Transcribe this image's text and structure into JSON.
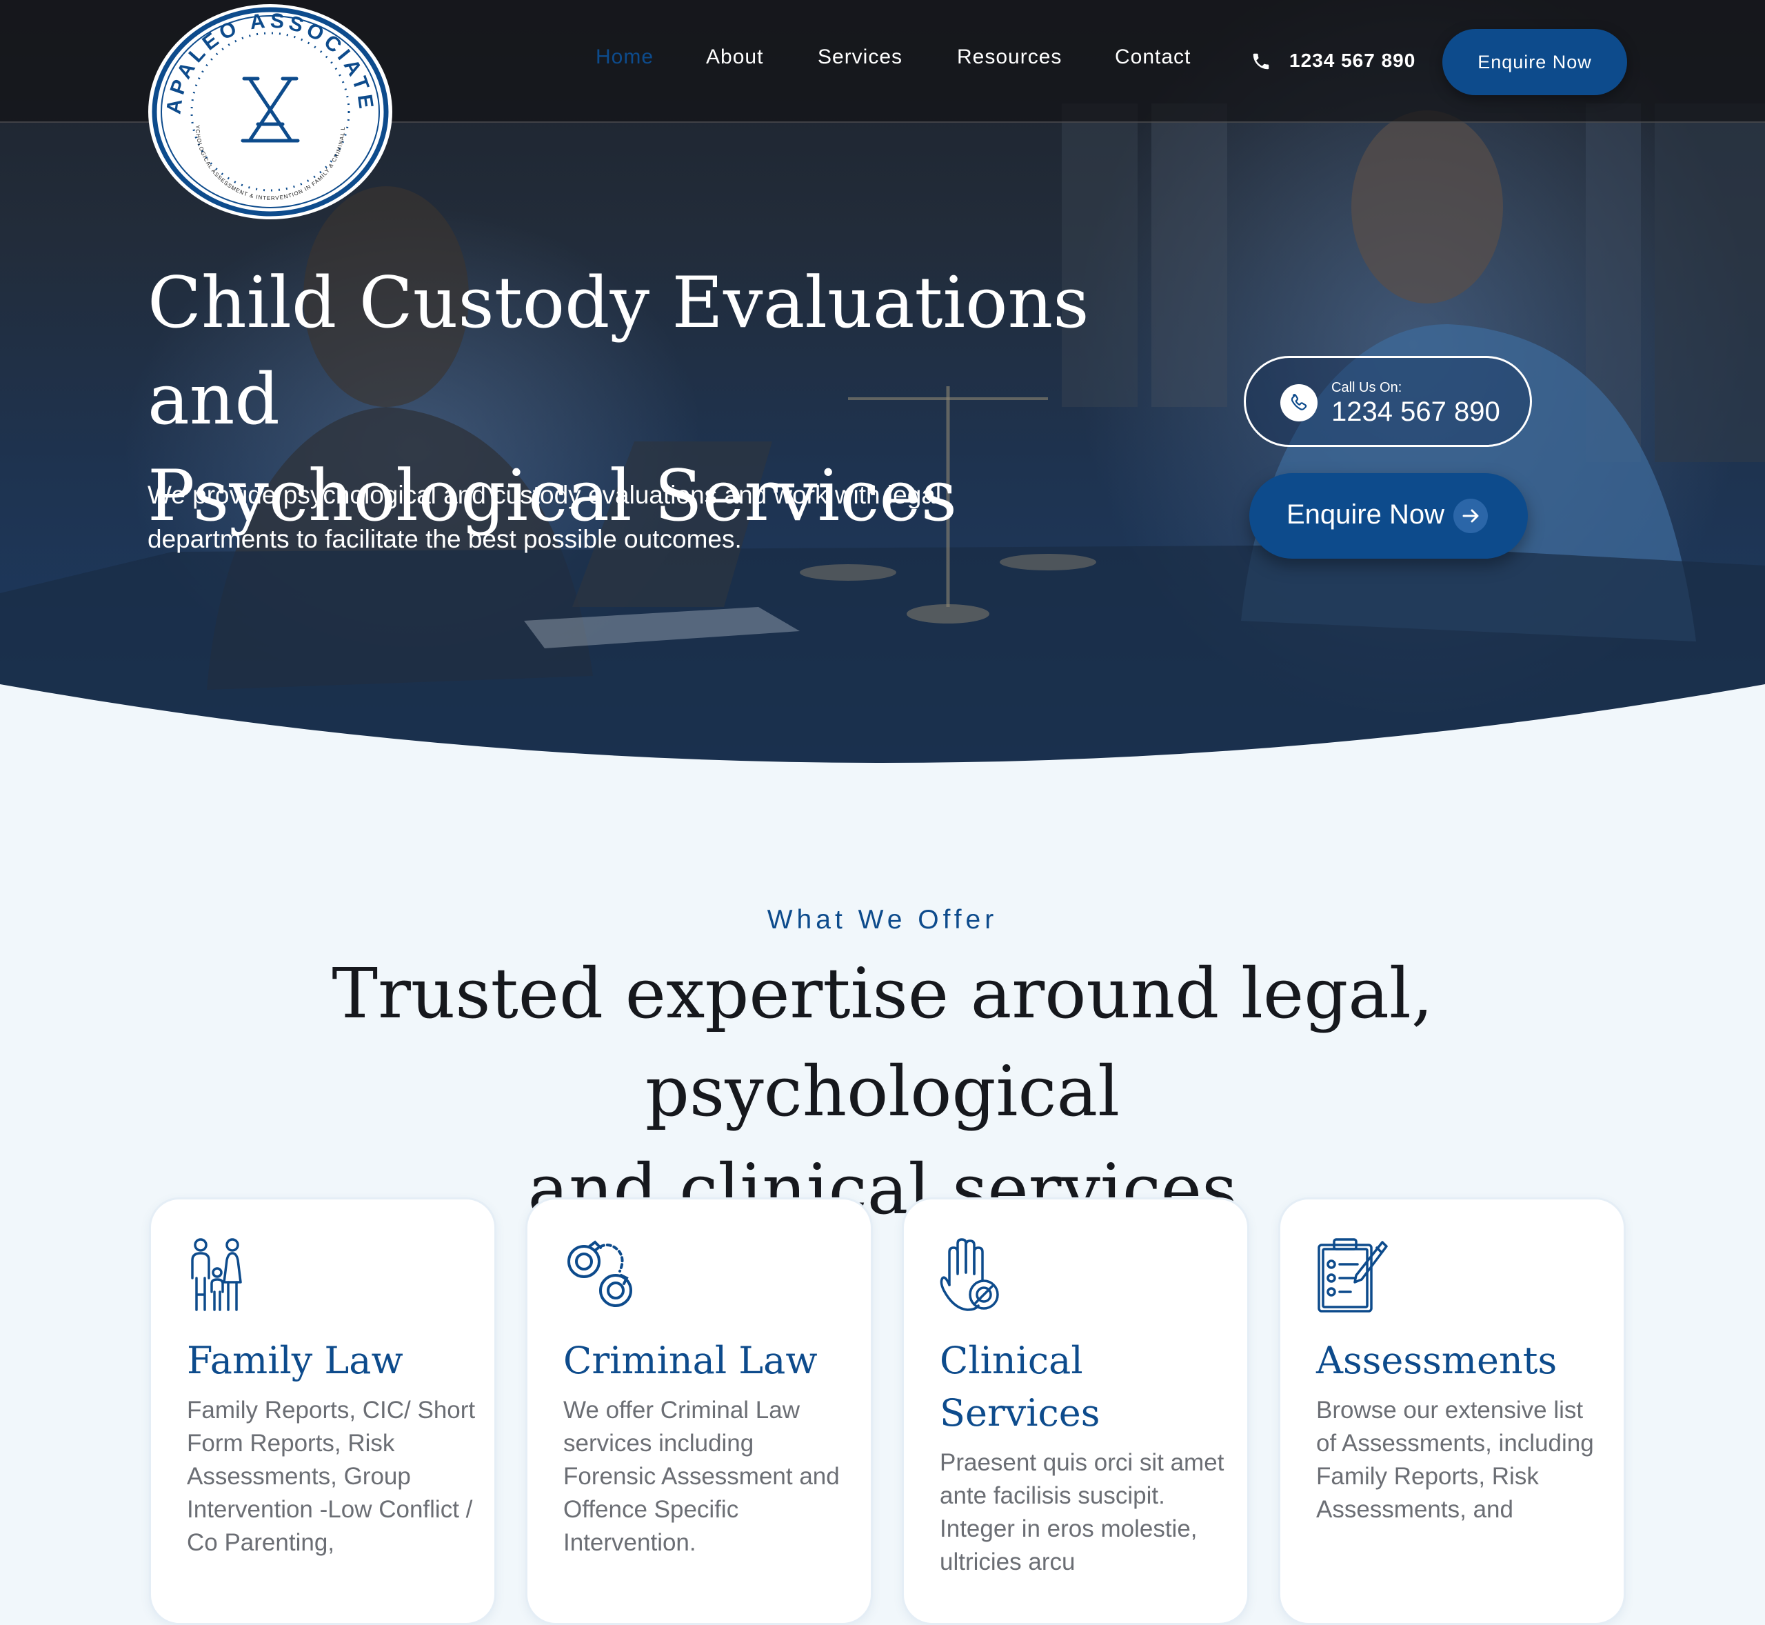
{
  "logo": {
    "arc_text": "PAPALEO ASSOCIATES",
    "tagline": "PSYCHOLOGICAL ASSESSMENT & INTERVENTION IN FAMILY & CRIMINAL LAW"
  },
  "nav": {
    "items": [
      "Home",
      "About",
      "Services",
      "Resources",
      "Contact"
    ],
    "active": "Home",
    "phone": "1234 567 890",
    "cta": "Enquire Now"
  },
  "hero": {
    "title_line1": "Child Custody Evaluations and",
    "title_line2": "Psychological Services",
    "subtitle_line1": "We provide psychological and custody evaluations and work with legal",
    "subtitle_line2": "departments to facilitate the best possible outcomes.",
    "call_label": "Call Us On:",
    "call_number": "1234 567 890",
    "cta": "Enquire Now"
  },
  "offer": {
    "eyebrow": "What We Offer",
    "title_line1": "Trusted expertise around legal, psychological",
    "title_line2": "and clinical services",
    "cards": [
      {
        "icon": "family-icon",
        "title": "Family Law",
        "text": "Family Reports, CIC/ Short Form Reports, Risk Assessments, Group Intervention -Low Conflict / Co Parenting,"
      },
      {
        "icon": "handcuffs-icon",
        "title": "Criminal Law",
        "text": "We offer Criminal Law services including Forensic Assessment and Offence Specific Intervention."
      },
      {
        "icon": "hand-stop-icon",
        "title": "Clinical Services",
        "text": "Praesent quis orci sit amet ante facilisis suscipit. Integer in eros molestie, ultricies arcu"
      },
      {
        "icon": "clipboard-checklist-icon",
        "title": "Assessments",
        "text": "Browse our extensive list of Assessments, including Family Reports, Risk Assessments, and"
      }
    ]
  },
  "colors": {
    "brand": "#0d4b8c",
    "page_bg": "#f1f7fb",
    "heading": "#16181d",
    "body_text": "#6b6e74"
  }
}
